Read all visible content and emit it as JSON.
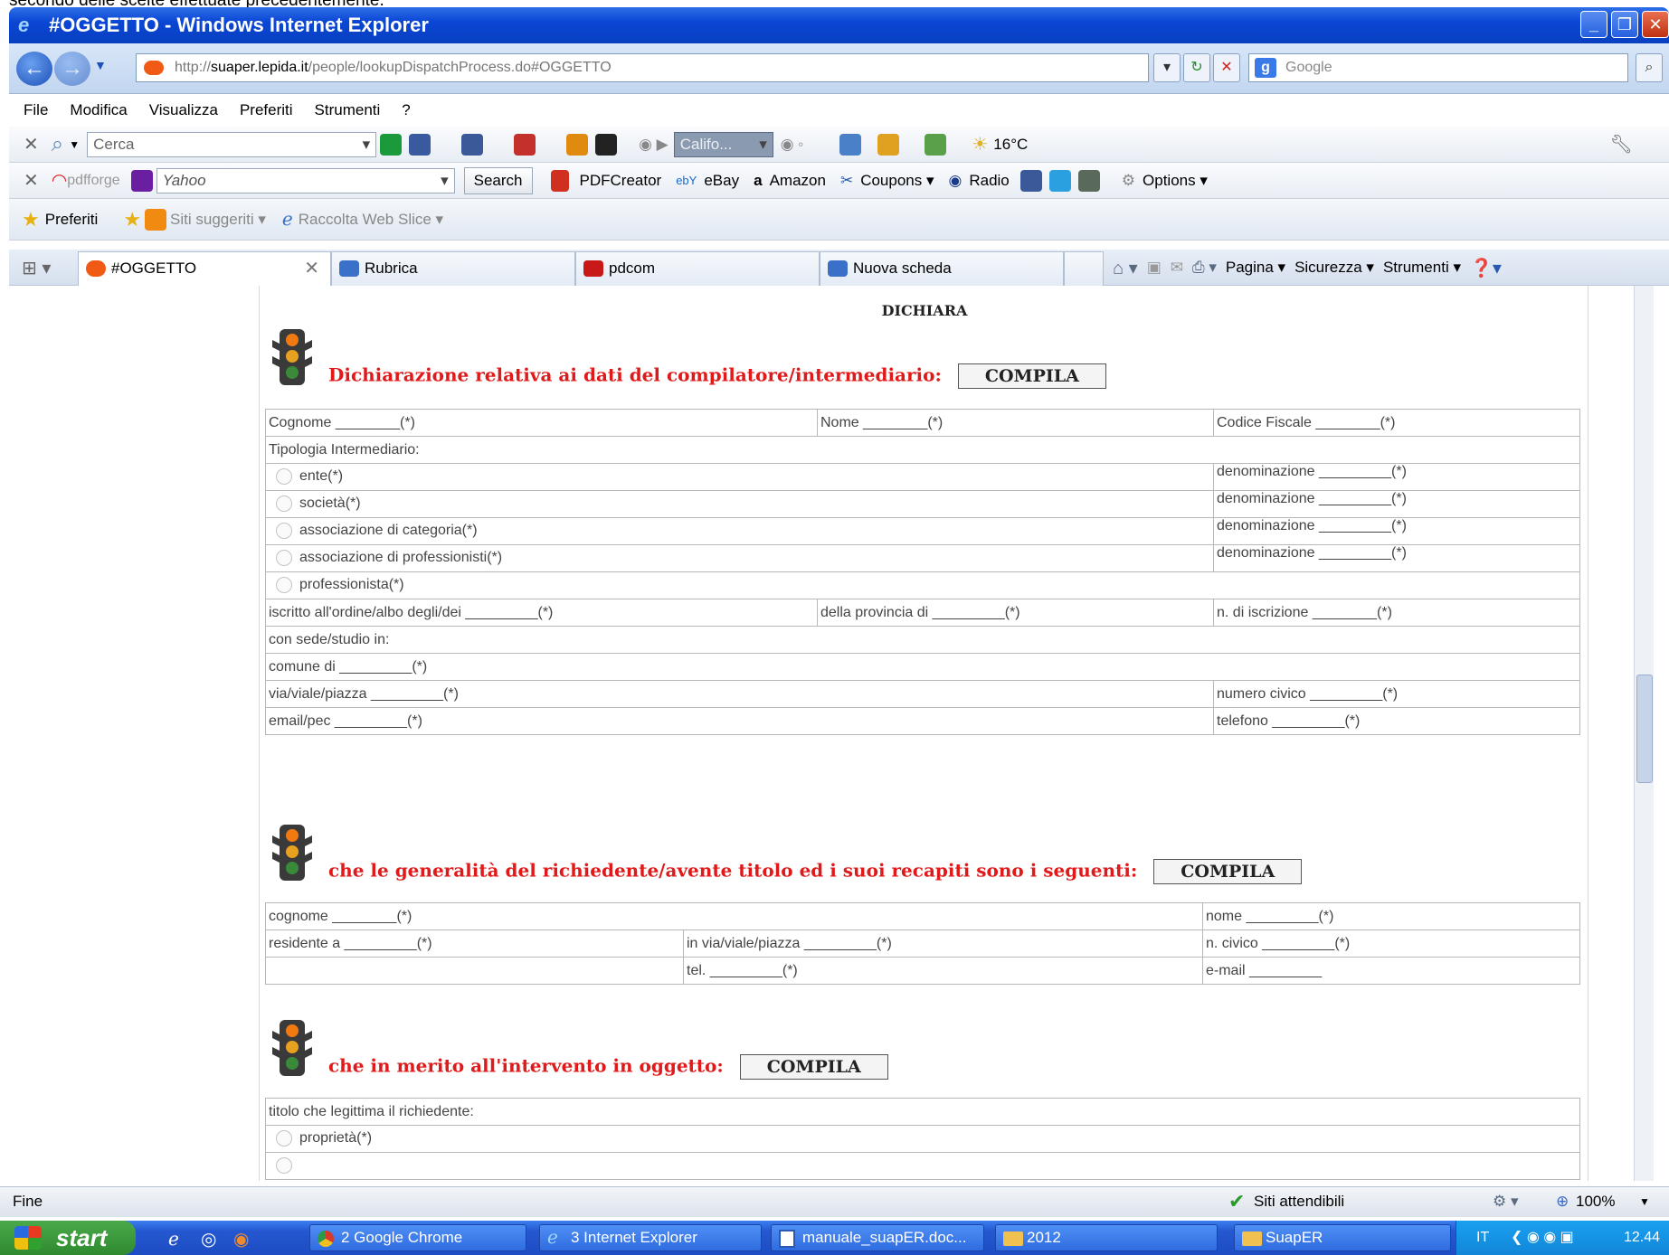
{
  "window": {
    "top_cut_text": "secondo delle scelte effettuate precedentemente.",
    "title": "#OGGETTO - Windows Internet Explorer"
  },
  "address": {
    "url_prefix": "http://",
    "url_host": "suaper.lepida.it",
    "url_path": "/people/lookupDispatchProcess.do#OGGETTO",
    "search_placeholder": "Google"
  },
  "menu": [
    "File",
    "Modifica",
    "Visualizza",
    "Preferiti",
    "Strumenti",
    "?"
  ],
  "toolbar1": {
    "search_placeholder": "Cerca",
    "radio_station": "Califo...",
    "weather": "16°C"
  },
  "toolbar2": {
    "brand": "pdfforge",
    "yahoo": "Yahoo",
    "search_btn": "Search",
    "items": [
      "PDFCreator",
      "eBay",
      "Amazon",
      "Coupons ▾",
      "Radio"
    ],
    "options": "Options ▾"
  },
  "favbar": {
    "preferiti": "Preferiti",
    "siti": "Siti suggeriti ▾",
    "raccolta": "Raccolta Web Slice ▾"
  },
  "tabs": [
    {
      "label": "#OGGETTO"
    },
    {
      "label": "Rubrica"
    },
    {
      "label": "pdcom"
    },
    {
      "label": "Nuova scheda"
    }
  ],
  "commands": [
    "Pagina ▾",
    "Sicurezza ▾",
    "Strumenti ▾"
  ],
  "page": {
    "heading": "DICHIARA",
    "compila": "COMPILA",
    "section1": {
      "title": "Dichiarazione relativa ai dati del compilatore/intermediario:",
      "cognome": "Cognome ________(*)",
      "nome": "Nome ________(*)",
      "codice_fiscale": "Codice Fiscale ________(*)",
      "tipologia": "Tipologia Intermediario:",
      "options": [
        "ente(*)",
        "società(*)",
        "associazione di categoria(*)",
        "associazione di professionisti(*)",
        "professionista(*)"
      ],
      "denominazione": "denominazione _________(*)",
      "iscritto": "iscritto all'ordine/albo degli/dei _________(*)",
      "provincia": "della provincia di _________(*)",
      "n_iscrizione": "n. di iscrizione ________(*)",
      "sede": "con sede/studio in:",
      "comune": "comune di _________(*)",
      "via": "via/viale/piazza _________(*)",
      "numero_civico": "numero civico _________(*)",
      "email": "email/pec _________(*)",
      "telefono": "telefono _________(*)"
    },
    "section2": {
      "title": "che le generalità del richiedente/avente titolo ed i suoi recapiti sono i seguenti:",
      "cognome": "cognome ________(*)",
      "nome": "nome _________(*)",
      "residente": "residente a _________(*)",
      "via": "in via/viale/piazza _________(*)",
      "civico": "n. civico _________(*)",
      "tel": "tel. _________(*)",
      "email": "e-mail _________"
    },
    "section3": {
      "title": "che in merito all'intervento in oggetto:",
      "titolo": "titolo che legittima il richiedente:",
      "proprieta": "proprietà(*)"
    }
  },
  "statusbar": {
    "left": "Fine",
    "zone": "Siti attendibili",
    "zoom": "100%"
  },
  "taskbar": {
    "start": "start",
    "tasks": [
      "2 Google Chrome",
      "3 Internet Explorer",
      "manuale_suapER.doc...",
      "2012",
      "SuapER"
    ],
    "lang": "IT",
    "time": "12.44"
  }
}
